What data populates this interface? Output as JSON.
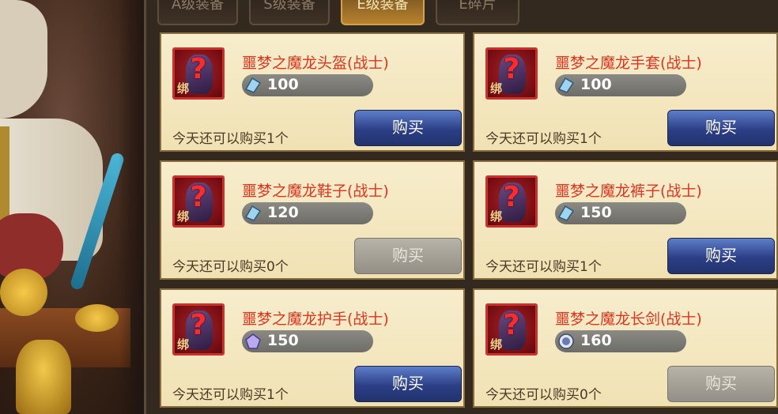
{
  "tabs": [
    {
      "label": "A级装备",
      "active": false
    },
    {
      "label": "S级装备",
      "active": false
    },
    {
      "label": "E级装备",
      "active": true
    },
    {
      "label": "E碎片",
      "active": false
    }
  ],
  "items": [
    {
      "name": "噩梦之魔龙头盔(战士)",
      "price": "100",
      "currency_icon": "blue-crystal-icon",
      "limit": "今天还可以购买1个",
      "buy_label": "购买",
      "buy_enabled": true,
      "bind_label": "绑"
    },
    {
      "name": "噩梦之魔龙手套(战士)",
      "price": "100",
      "currency_icon": "blue-crystal-icon",
      "limit": "今天还可以购买1个",
      "buy_label": "购买",
      "buy_enabled": true,
      "bind_label": "绑"
    },
    {
      "name": "噩梦之魔龙鞋子(战士)",
      "price": "120",
      "currency_icon": "blue-crystal-icon",
      "limit": "今天还可以购买0个",
      "buy_label": "购买",
      "buy_enabled": false,
      "bind_label": "绑"
    },
    {
      "name": "噩梦之魔龙裤子(战士)",
      "price": "150",
      "currency_icon": "blue-crystal-icon",
      "limit": "今天还可以购买1个",
      "buy_label": "购买",
      "buy_enabled": true,
      "bind_label": "绑"
    },
    {
      "name": "噩梦之魔龙护手(战士)",
      "price": "150",
      "currency_icon": "purple-gem-icon",
      "limit": "今天还可以购买1个",
      "buy_label": "购买",
      "buy_enabled": true,
      "bind_label": "绑"
    },
    {
      "name": "噩梦之魔龙长剑(战士)",
      "price": "160",
      "currency_icon": "round-gem-icon",
      "limit": "今天还可以购买0个",
      "buy_label": "购买",
      "buy_enabled": false,
      "bind_label": "绑"
    }
  ],
  "colors": {
    "item_name": "#e0341f",
    "buy_button": "#2c3f86",
    "buy_disabled": "#948f86",
    "active_tab": "#b7822f"
  }
}
